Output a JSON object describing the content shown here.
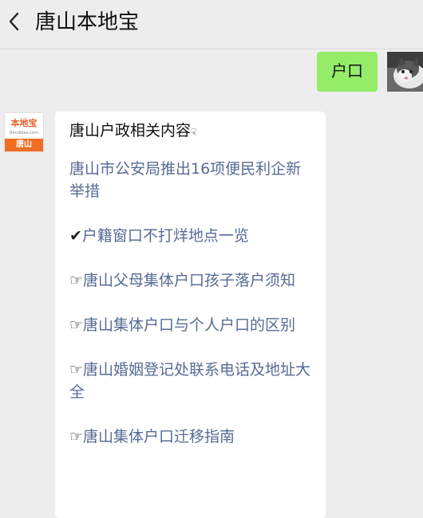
{
  "header": {
    "title": "唐山本地宝",
    "back_icon": "chevron-left-icon"
  },
  "outgoing": {
    "text": "户口"
  },
  "brand": {
    "name": "本地宝",
    "sub": "Bendibao.com",
    "city": "唐山",
    "color": "#f06d23"
  },
  "incoming": {
    "heading": "唐山户政相关内容",
    "heading_mark": "☟",
    "links": [
      {
        "prefix": "",
        "text": "唐山市公安局推出16项便民利企新举措"
      },
      {
        "prefix": "✔",
        "text": "户籍窗口不打烊地点一览"
      },
      {
        "prefix": "☞",
        "text": "唐山父母集体户口孩子落户须知"
      },
      {
        "prefix": "☞",
        "text": "唐山集体户口与个人户口的区别"
      },
      {
        "prefix": "☞",
        "text": "唐山婚姻登记处联系电话及地址大全"
      },
      {
        "prefix": "☞",
        "text": "唐山集体户口迁移指南"
      }
    ]
  },
  "colors": {
    "outgoing_bubble": "#95ec69",
    "link": "#576b95",
    "background": "#ededed"
  }
}
